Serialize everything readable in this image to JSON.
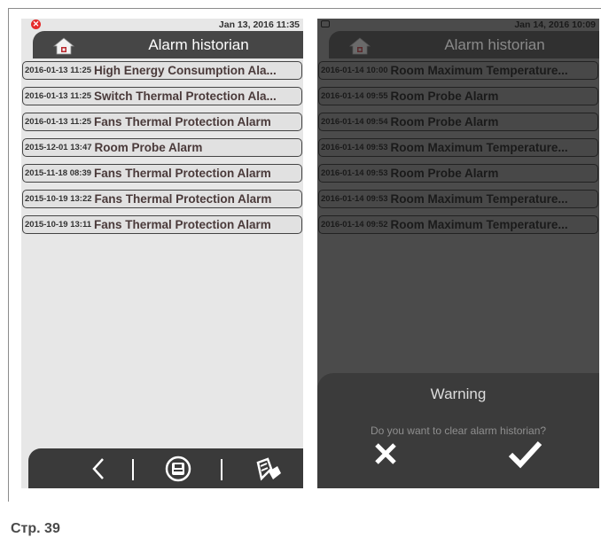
{
  "left_screen": {
    "status_datetime": "Jan 13, 2016  11:35",
    "title": "Alarm historian",
    "alarms": [
      {
        "time": "2016-01-13 11:25",
        "message": "High Energy Consumption Ala..."
      },
      {
        "time": "2016-01-13 11:25",
        "message": "Switch Thermal Protection Ala..."
      },
      {
        "time": "2016-01-13 11:25",
        "message": "Fans Thermal Protection Alarm"
      },
      {
        "time": "2015-12-01 13:47",
        "message": "Room Probe Alarm"
      },
      {
        "time": "2015-11-18 08:39",
        "message": "Fans Thermal Protection Alarm"
      },
      {
        "time": "2015-10-19 13:22",
        "message": "Fans Thermal Protection Alarm"
      },
      {
        "time": "2015-10-19 13:11",
        "message": "Fans Thermal Protection Alarm"
      }
    ],
    "bottom_bar": {
      "back_icon": "chevron-left-icon",
      "save_icon": "save-icon",
      "clear_icon": "eraser-icon"
    }
  },
  "right_screen": {
    "status_datetime": "Jan 14, 2016  10:09",
    "title": "Alarm historian",
    "alarms": [
      {
        "time": "2016-01-14 10:00",
        "message": "Room Maximum Temperature..."
      },
      {
        "time": "2016-01-14 09:55",
        "message": "Room Probe Alarm"
      },
      {
        "time": "2016-01-14 09:54",
        "message": "Room Probe Alarm"
      },
      {
        "time": "2016-01-14 09:53",
        "message": "Room Maximum Temperature..."
      },
      {
        "time": "2016-01-14 09:53",
        "message": "Room Probe Alarm"
      },
      {
        "time": "2016-01-14 09:53",
        "message": "Room Maximum Temperature..."
      },
      {
        "time": "2016-01-14 09:52",
        "message": "Room Maximum Temperature..."
      }
    ],
    "dialog": {
      "title": "Warning",
      "question": "Do you want to clear alarm historian?",
      "cancel_icon": "close-icon",
      "confirm_icon": "checkmark-icon"
    }
  },
  "footer": {
    "page_label": "Стр. 39"
  },
  "colors": {
    "error_red": "#e52b2b",
    "header_dark": "#464646",
    "screen_light": "#e7e7e7",
    "screen_dim": "#4b4b4b"
  }
}
